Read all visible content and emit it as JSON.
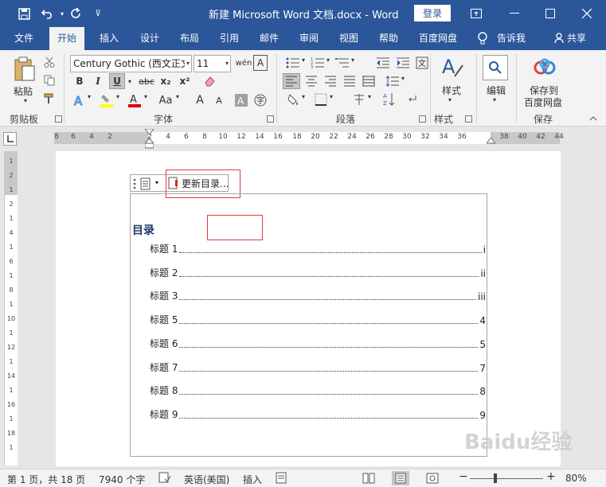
{
  "window": {
    "title": "新建 Microsoft Word 文档.docx  -  Word",
    "login": "登录"
  },
  "tabs": [
    "文件",
    "开始",
    "插入",
    "设计",
    "布局",
    "引用",
    "邮件",
    "审阅",
    "视图",
    "帮助",
    "百度网盘"
  ],
  "tell_me": "告诉我",
  "share": "共享",
  "ribbon": {
    "clipboard": {
      "paste": "粘贴",
      "label": "剪贴板"
    },
    "font": {
      "name": "Century Gothic (西文正文)",
      "size": "11",
      "bold": "B",
      "italic": "I",
      "underline": "U",
      "strike": "abc",
      "subscript": "x₂",
      "superscript": "x²",
      "grow": "A",
      "shrink": "A",
      "case": "Aa",
      "label": "字体"
    },
    "paragraph": {
      "label": "段落"
    },
    "styles": {
      "styles": "样式",
      "label": "样式"
    },
    "editing": {
      "edit": "编辑"
    },
    "save": {
      "line1": "保存到",
      "line2": "百度网盘",
      "label": "保存"
    }
  },
  "ruler": {
    "ticks": [
      "8",
      "6",
      "4",
      "2",
      "2",
      "4",
      "6",
      "8",
      "10",
      "12",
      "14",
      "16",
      "18",
      "20",
      "22",
      "24",
      "26",
      "28",
      "30",
      "32",
      "34",
      "36",
      "38",
      "40",
      "42",
      "44"
    ],
    "vticks": [
      "1",
      "2",
      "1",
      "2",
      "1",
      "4",
      "1",
      "6",
      "1",
      "8",
      "1",
      "10",
      "1",
      "12",
      "1",
      "14",
      "1",
      "16",
      "1",
      "18",
      "1"
    ]
  },
  "toc": {
    "update_button": "更新目录...",
    "heading": "目录",
    "entries": [
      {
        "title": "标题 1",
        "page": "i"
      },
      {
        "title": "标题 2",
        "page": "ii"
      },
      {
        "title": "标题 3",
        "page": "iii"
      },
      {
        "title": "标题 5",
        "page": "4"
      },
      {
        "title": "标题 6",
        "page": "5"
      },
      {
        "title": "标题 7",
        "page": "7"
      },
      {
        "title": "标题 8",
        "page": "8"
      },
      {
        "title": "标题 9",
        "page": "9"
      }
    ]
  },
  "status": {
    "page": "第 1 页，共 18 页",
    "words": "7940 个字",
    "language": "英语(美国)",
    "mode": "插入",
    "zoom": "80%",
    "zoom_minus": "−",
    "zoom_plus": "+"
  },
  "watermark": "Baidu经验",
  "colors": {
    "brand": "#2b579a",
    "highlight": "#ffff00",
    "font_color": "#e00000",
    "annotation": "#e0393e"
  }
}
